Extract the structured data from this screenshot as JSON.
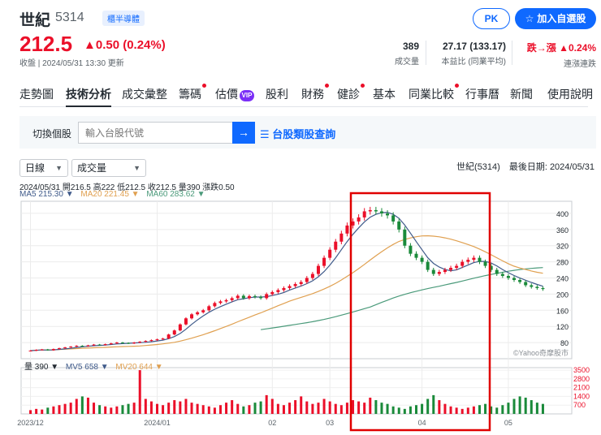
{
  "header": {
    "name": "世紀",
    "code": "5314",
    "tag": "櫃半導體",
    "pk_label": "PK",
    "watch_label": "加入自選股",
    "price": "212.5",
    "change": "▲0.50 (0.24%)",
    "time": "收盤 | 2024/05/31 13:30 更新",
    "stats": [
      {
        "value": "389",
        "label": "成交量"
      },
      {
        "value": "27.17 (133.17)",
        "label": "本益比 (同業平均)"
      },
      {
        "value": "跌→漲 ▲0.24%",
        "label": "連漲連跌"
      }
    ]
  },
  "tabs": [
    "走勢圖",
    "技術分析",
    "成交彙整",
    "籌碼",
    "估價",
    "股利",
    "財務",
    "健診",
    "基本",
    "同業比較",
    "行事曆",
    "新聞",
    "使用說明"
  ],
  "vip_badge": "VIP",
  "search": {
    "label": "切換個股",
    "placeholder": "輸入台股代號",
    "category": "台股類股查詢"
  },
  "controls": {
    "period": "日線",
    "indicator": "成交量",
    "latest": "世紀(5314)　最後日期: 2024/05/31"
  },
  "ohlc_line": "2024/05/31 開216.5 高222 低212.5 收212.5 量390 漲跌0.50",
  "ma_legend": [
    {
      "label": "MA5 215.30 ▼",
      "color": "#3f5a8a"
    },
    {
      "label": "MA20 221.45 ▼",
      "color": "#e0a050"
    },
    {
      "label": "MA60 283.62 ▼",
      "color": "#4a9a7a"
    }
  ],
  "vol_legend": [
    {
      "label": "量 390 ▼",
      "color": "#232a31"
    },
    {
      "label": "MV5 658 ▼",
      "color": "#3f5a8a"
    },
    {
      "label": "MV20 644 ▼",
      "color": "#e0a050"
    }
  ],
  "chart_data": {
    "type": "candlestick",
    "price_axis": [
      400,
      360,
      320,
      280,
      240,
      200,
      160,
      120,
      80
    ],
    "volume_axis": [
      3500,
      2800,
      2100,
      1400,
      700
    ],
    "x_labels": [
      "2023/12",
      "2024/01",
      "02",
      "03",
      "04",
      "05"
    ],
    "watermark": "©Yahoo奇摩股市",
    "closes": [
      60,
      62,
      63,
      61,
      64,
      66,
      68,
      70,
      72,
      71,
      73,
      75,
      74,
      76,
      78,
      80,
      79,
      78,
      80,
      82,
      84,
      86,
      88,
      90,
      100,
      110,
      125,
      140,
      150,
      155,
      160,
      170,
      178,
      182,
      185,
      190,
      196,
      190,
      195,
      193,
      190,
      200,
      205,
      210,
      215,
      220,
      225,
      230,
      240,
      250,
      270,
      290,
      310,
      330,
      350,
      370,
      380,
      390,
      405,
      408,
      405,
      400,
      395,
      380,
      360,
      320,
      300,
      290,
      280,
      260,
      250,
      255,
      260,
      265,
      270,
      280,
      285,
      290,
      280,
      270,
      260,
      250,
      245,
      240,
      235,
      230,
      222,
      218,
      215,
      212.5
    ],
    "volumes": [
      300,
      400,
      350,
      500,
      600,
      700,
      800,
      900,
      1200,
      1400,
      1300,
      900,
      700,
      600,
      500,
      600,
      700,
      800,
      900,
      3500,
      1200,
      1000,
      800,
      700,
      900,
      1100,
      1000,
      1200,
      900,
      800,
      700,
      600,
      500,
      700,
      900,
      1100,
      800,
      600,
      700,
      900,
      1000,
      1500,
      1200,
      800,
      700,
      900,
      1100,
      1400,
      1000,
      800,
      900,
      1200,
      1000,
      800,
      700,
      900,
      1100,
      1000,
      900,
      1300,
      1100,
      900,
      800,
      600,
      500,
      400,
      600,
      700,
      800,
      1200,
      1500,
      1100,
      800,
      600,
      500,
      400,
      500,
      600,
      700,
      800,
      600,
      500,
      700,
      900,
      1200,
      1400,
      1300,
      1100,
      900,
      800
    ]
  }
}
